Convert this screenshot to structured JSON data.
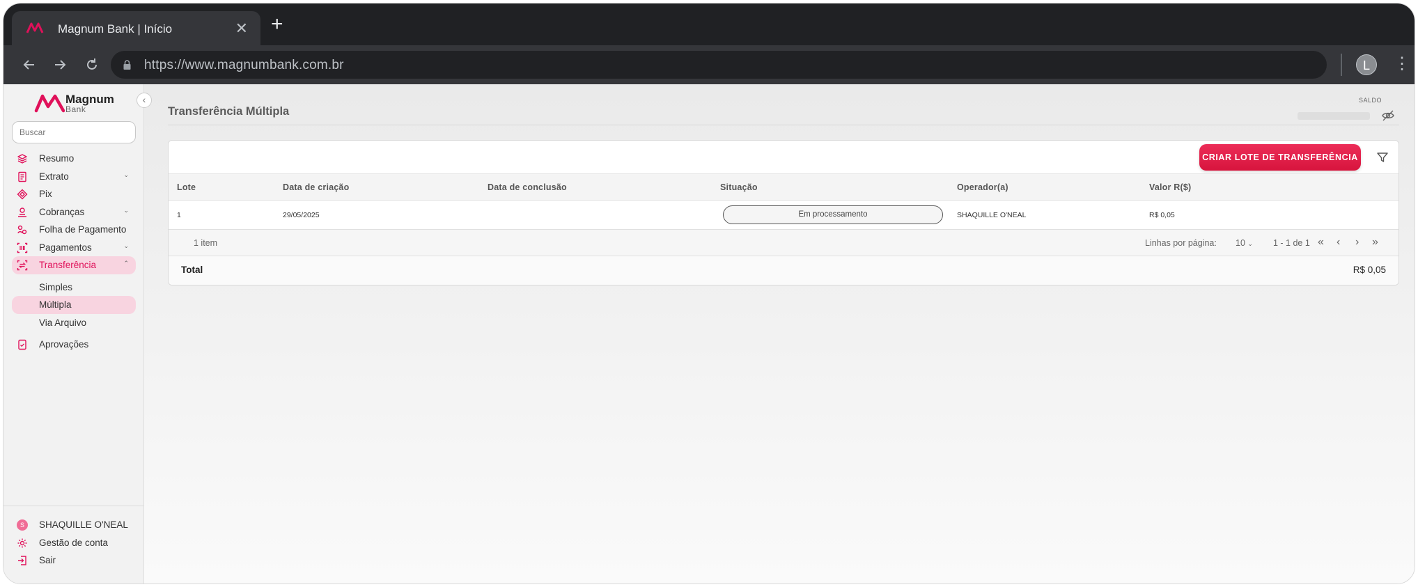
{
  "browser": {
    "tab_title": "Magnum Bank  |  Início",
    "tab_close": "✕",
    "new_tab": "+",
    "url": "https://www.magnumbank.com.br",
    "profile_initial": "L"
  },
  "brand": {
    "name": "Magnum",
    "sub": "Bank",
    "accent": "#e0115a"
  },
  "sidebar": {
    "search_placeholder": "Buscar",
    "items": [
      {
        "label": "Resumo",
        "icon": "layers-icon"
      },
      {
        "label": "Extrato",
        "icon": "document-icon",
        "chevron": "⌄"
      },
      {
        "label": "Pix",
        "icon": "pix-icon"
      },
      {
        "label": "Cobranças",
        "icon": "billing-icon",
        "chevron": "⌄"
      },
      {
        "label": "Folha de Pagamento",
        "icon": "payroll-icon"
      },
      {
        "label": "Pagamentos",
        "icon": "barcode-icon",
        "chevron": "⌄"
      },
      {
        "label": "Transferência",
        "icon": "transfer-icon",
        "chevron": "⌃"
      }
    ],
    "subitems": [
      {
        "label": "Simples"
      },
      {
        "label": "Múltipla"
      },
      {
        "label": "Via Arquivo"
      }
    ],
    "approvals": {
      "label": "Aprovações",
      "icon": "approval-icon"
    },
    "footer": {
      "user_initial": "S",
      "user_name": "SHAQUILLE O'NEAL",
      "account": "Gestão de conta",
      "logout": "Sair"
    }
  },
  "header": {
    "title": "Transferência Múltipla",
    "saldo_label": "SALDO"
  },
  "toolbar": {
    "create_label": "CRIAR LOTE DE TRANSFERÊNCIA"
  },
  "table": {
    "columns": [
      "Lote",
      "Data de criação",
      "Data de conclusão",
      "Situação",
      "Operador(a)",
      "Valor R($)"
    ],
    "rows": [
      {
        "lote": "1",
        "criacao": "29/05/2025",
        "conclusao": "",
        "situacao": "Em processamento",
        "operador": "SHAQUILLE O'NEAL",
        "valor": "R$ 0,05"
      }
    ]
  },
  "pagination": {
    "count": "1 item",
    "rows_label": "Linhas por página:",
    "rows_value": "10",
    "range": "1 - 1 de 1"
  },
  "total": {
    "label": "Total",
    "value": "R$ 0,05"
  }
}
